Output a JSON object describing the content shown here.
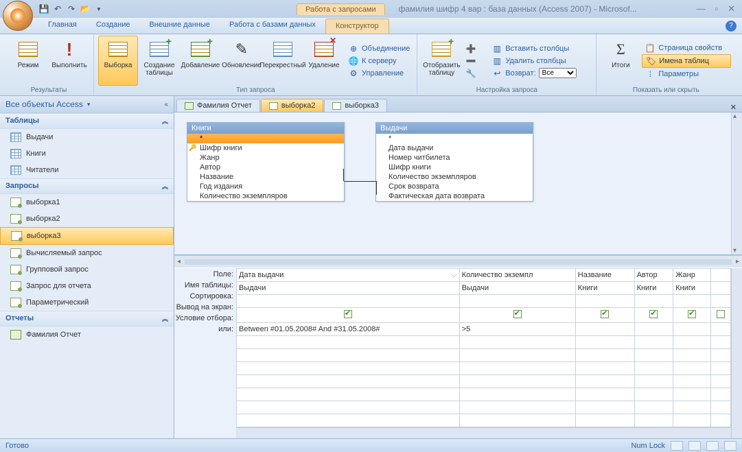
{
  "window": {
    "context_tab": "Работа с запросами",
    "title": "фамилия шифр 4 вар : база данных (Access 2007) - Microsof..."
  },
  "menu": {
    "tabs": [
      "Главная",
      "Создание",
      "Внешние данные",
      "Работа с базами данных",
      "Конструктор"
    ],
    "active": 4
  },
  "ribbon": {
    "group1": {
      "label": "Результаты",
      "btn_view": "Режим",
      "btn_run": "Выполнить"
    },
    "group2": {
      "label": "Тип запроса",
      "btn_select": "Выборка",
      "btn_maketable": "Создание таблицы",
      "btn_append": "Добавление",
      "btn_update": "Обновление",
      "btn_crosstab": "Перекрестный",
      "btn_delete": "Удаление",
      "union": "Объединение",
      "server": "К серверу",
      "control": "Управление"
    },
    "group3": {
      "label": "Настройка запроса",
      "btn_showtable": "Отобразить таблицу",
      "insert_cols": "Вставить столбцы",
      "delete_cols": "Удалить столбцы",
      "return_label": "Возврат:",
      "return_value": "Все"
    },
    "group4": {
      "label": "Показать или скрыть",
      "btn_totals": "Итоги",
      "prop_sheet": "Страница свойств",
      "table_names": "Имена таблиц",
      "params": "Параметры"
    }
  },
  "nav": {
    "header": "Все объекты Access",
    "groups": [
      {
        "title": "Таблицы",
        "type": "table",
        "items": [
          "Выдачи",
          "Книги",
          "Читатели"
        ]
      },
      {
        "title": "Запросы",
        "type": "query",
        "items": [
          "выборка1",
          "выборка2",
          "выборка3",
          "Вычисляемый запрос",
          "Групповой запрос",
          "Запрос для отчета",
          "Параметрический"
        ],
        "selected": 2
      },
      {
        "title": "Отчеты",
        "type": "report",
        "items": [
          "Фамилия Отчет"
        ]
      }
    ]
  },
  "doc_tabs": {
    "items": [
      "Фамилия Отчет",
      "выборка2",
      "выборка3"
    ],
    "active": 1
  },
  "diagram": {
    "tables": [
      {
        "title": "Книги",
        "selected_row": "*",
        "key": "Шифр книги",
        "fields": [
          "Жанр",
          "Автор",
          "Название",
          "Год издания",
          "Количество экземпляров"
        ]
      },
      {
        "title": "Выдачи",
        "selected_row": "",
        "fields": [
          "*",
          "Дата выдачи",
          "Номер читбилета",
          "Шифр книги",
          "Количество экземпляров",
          "Срок возврата",
          "Фактическая дата возврата"
        ]
      }
    ]
  },
  "grid": {
    "rows": [
      "Поле:",
      "Имя таблицы:",
      "Сортировка:",
      "Вывод на экран:",
      "Условие отбора:",
      "или:"
    ],
    "cols": [
      {
        "field": "Дата выдачи",
        "table": "Выдачи",
        "show": true,
        "criteria": "Between #01.05.2008# And #31.05.2008#"
      },
      {
        "field": "Количество экземпл",
        "table": "Выдачи",
        "show": true,
        "criteria": ">5"
      },
      {
        "field": "Название",
        "table": "Книги",
        "show": true,
        "criteria": ""
      },
      {
        "field": "Автор",
        "table": "Книги",
        "show": true,
        "criteria": ""
      },
      {
        "field": "Жанр",
        "table": "Книги",
        "show": true,
        "criteria": ""
      }
    ]
  },
  "status": {
    "left": "Готово",
    "numlock": "Num Lock"
  }
}
